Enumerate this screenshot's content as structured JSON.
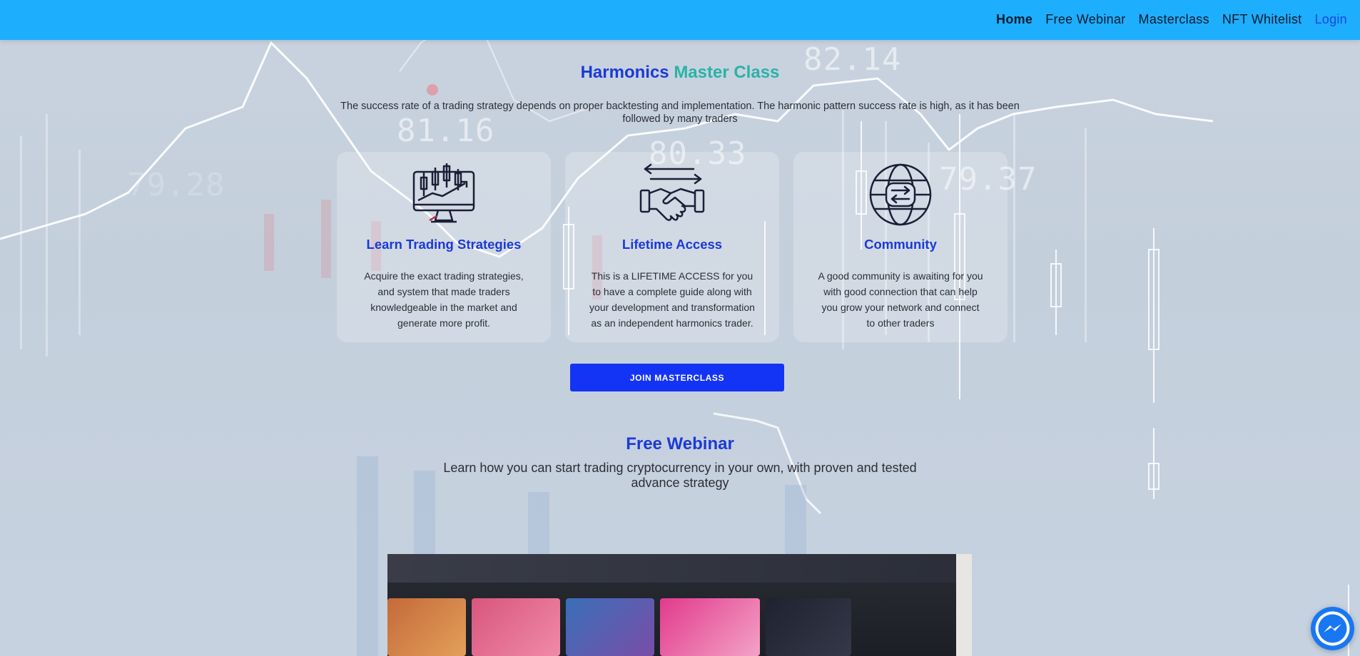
{
  "nav": {
    "links": [
      "Home",
      "Free Webinar",
      "Masterclass",
      "NFT Whitelist"
    ],
    "login": "Login"
  },
  "masterclass": {
    "title": "Harmonics",
    "title_accent": "Master Class",
    "description": "The success rate of a trading strategy depends on proper backtesting and implementation. The harmonic pattern success rate is high, as it has been followed by many traders",
    "cards": [
      {
        "icon": "monitor-candlestick-chart-icon",
        "title": "Learn Trading Strategies",
        "text": "Acquire the exact trading strategies, and system that made traders knowledgeable in the market and generate more profit."
      },
      {
        "icon": "handshake-icon",
        "title": "Lifetime Access",
        "text": "This is a LIFETIME ACCESS for you to have a complete guide along with your development and transformation as an independent harmonics trader."
      },
      {
        "icon": "globe-exchange-icon",
        "title": "Community",
        "text": "A good community is awaiting for you with good connection that can help you grow your network and connect to other traders"
      }
    ],
    "join_button": "JOIN MASTERCLASS"
  },
  "webinar": {
    "title": "Free Webinar",
    "description": "Learn how you can start trading cryptocurrency in your own, with proven and tested advance strategy"
  },
  "background_numbers": [
    "82.14",
    "81.16",
    "80.33",
    "79.37",
    "79.28"
  ],
  "colors": {
    "navbar": "#1eaefe",
    "heading_blue": "#1b3ad6",
    "accent_teal": "#2ab3a8",
    "button": "#1434f5",
    "messenger": "#1877f2"
  }
}
